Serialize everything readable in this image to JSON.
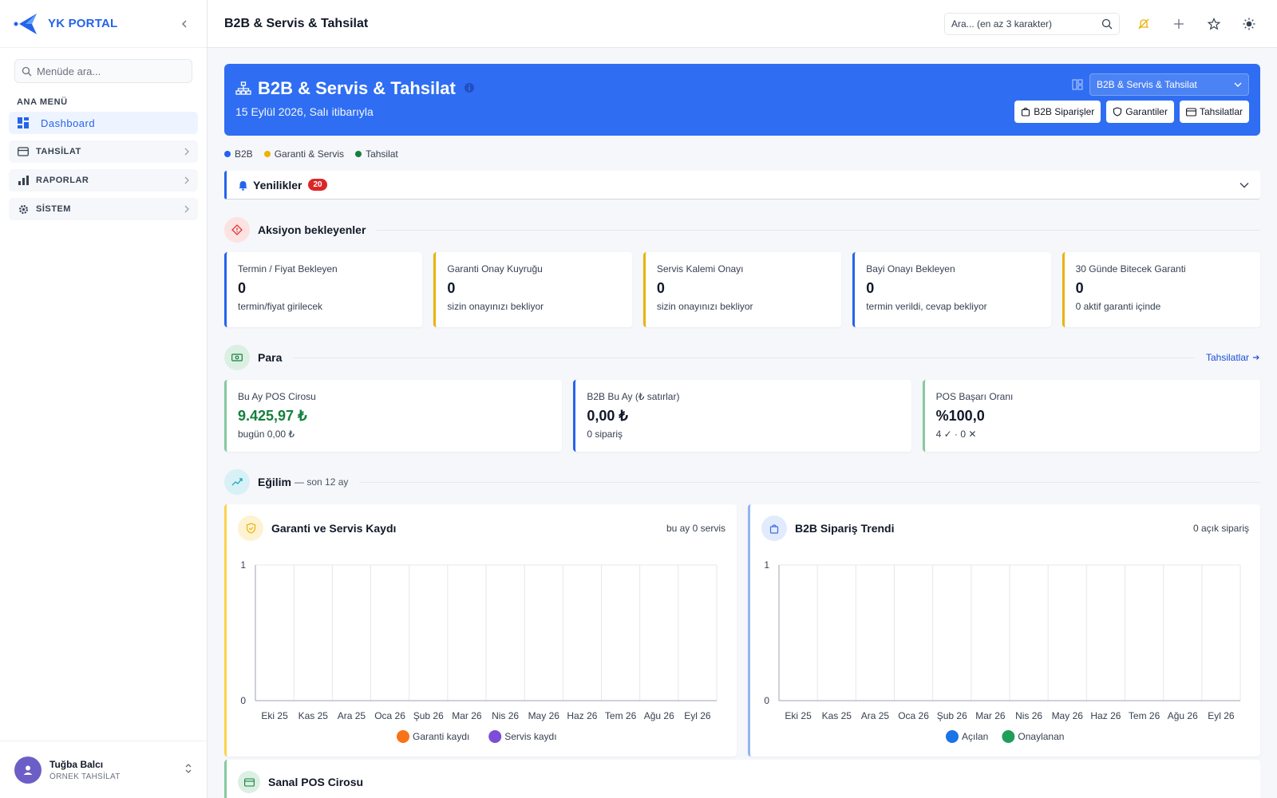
{
  "brand": {
    "name": "YK PORTAL"
  },
  "sidebar": {
    "search_placeholder": "Menüde ara...",
    "heading": "ANA MENÜ",
    "items": [
      {
        "label": "Dashboard"
      },
      {
        "label": "TAHSİLAT"
      },
      {
        "label": "RAPORLAR"
      },
      {
        "label": "SİSTEM"
      }
    ]
  },
  "user": {
    "name": "Tuğba Balcı",
    "role": "ÖRNEK TAHSİLAT"
  },
  "topbar": {
    "title": "B2B & Servis & Tahsilat",
    "search_placeholder": "Ara... (en az 3 karakter)"
  },
  "hero": {
    "title": "B2B & Servis & Tahsilat",
    "subtitle": "15 Eylül 2026, Salı itibarıyla",
    "view_select": "B2B & Servis & Tahsilat",
    "buttons": [
      "B2B Siparişler",
      "Garantiler",
      "Tahsilatlar"
    ],
    "color": "#2f6ef2"
  },
  "legend": [
    {
      "label": "B2B",
      "color": "#2563eb"
    },
    {
      "label": "Garanti & Servis",
      "color": "#eab308"
    },
    {
      "label": "Tahsilat",
      "color": "#15803d"
    }
  ],
  "news": {
    "title": "Yenilikler",
    "count": "20"
  },
  "actions": {
    "title": "Aksiyon bekleyenler",
    "cards": [
      {
        "label": "Termin / Fiyat Bekleyen",
        "value": "0",
        "sub": "termin/fiyat girilecek"
      },
      {
        "label": "Garanti Onay Kuyruğu",
        "value": "0",
        "sub": "sizin onayınızı bekliyor"
      },
      {
        "label": "Servis Kalemi Onayı",
        "value": "0",
        "sub": "sizin onayınızı bekliyor"
      },
      {
        "label": "Bayi Onayı Bekleyen",
        "value": "0",
        "sub": "termin verildi, cevap bekliyor"
      },
      {
        "label": "30 Günde Bitecek Garanti",
        "value": "0",
        "sub": "0 aktif garanti içinde"
      }
    ]
  },
  "money": {
    "title": "Para",
    "link": "Tahsilatlar",
    "cards": [
      {
        "label": "Bu Ay POS Cirosu",
        "value": "9.425,97 ₺",
        "sub": "bugün 0,00 ₺"
      },
      {
        "label": "B2B Bu Ay (₺ satırlar)",
        "value": "0,00 ₺",
        "sub": "0 sipariş"
      },
      {
        "label": "POS Başarı Oranı",
        "value": "%100,0",
        "sub": "4 ✓ · 0 ✕"
      }
    ]
  },
  "trend": {
    "title": "Eğilim",
    "subtitle": "— son 12 ay"
  },
  "chart_data": [
    {
      "type": "line",
      "title": "Garanti ve Servis Kaydı",
      "right_note": "bu ay 0 servis",
      "categories": [
        "Eki 25",
        "Kas 25",
        "Ara 25",
        "Oca 26",
        "Şub 26",
        "Mar 26",
        "Nis 26",
        "May 26",
        "Haz 26",
        "Tem 26",
        "Ağu 26",
        "Eyl 26"
      ],
      "ylim": [
        0,
        1
      ],
      "yticks": [
        "0",
        "1"
      ],
      "series": [
        {
          "name": "Garanti kaydı",
          "color": "#f97316",
          "values": [
            0,
            0,
            0,
            0,
            0,
            0,
            0,
            0,
            0,
            0,
            0,
            0
          ]
        },
        {
          "name": "Servis kaydı",
          "color": "#7c4dd6",
          "values": [
            0,
            0,
            0,
            0,
            0,
            0,
            0,
            0,
            0,
            0,
            0,
            0
          ]
        }
      ],
      "grid": true,
      "legend": "bottom"
    },
    {
      "type": "line",
      "title": "B2B Sipariş Trendi",
      "right_note": "0 açık sipariş",
      "categories": [
        "Eki 25",
        "Kas 25",
        "Ara 25",
        "Oca 26",
        "Şub 26",
        "Mar 26",
        "Nis 26",
        "May 26",
        "Haz 26",
        "Tem 26",
        "Ağu 26",
        "Eyl 26"
      ],
      "ylim": [
        0,
        1
      ],
      "yticks": [
        "0",
        "1"
      ],
      "series": [
        {
          "name": "Açılan",
          "color": "#1a73e8",
          "values": [
            0,
            0,
            0,
            0,
            0,
            0,
            0,
            0,
            0,
            0,
            0,
            0
          ]
        },
        {
          "name": "Onaylanan",
          "color": "#1e9e5a",
          "values": [
            0,
            0,
            0,
            0,
            0,
            0,
            0,
            0,
            0,
            0,
            0,
            0
          ]
        }
      ],
      "grid": true,
      "legend": "bottom"
    }
  ],
  "bottom": {
    "title": "Sanal POS Cirosu"
  }
}
